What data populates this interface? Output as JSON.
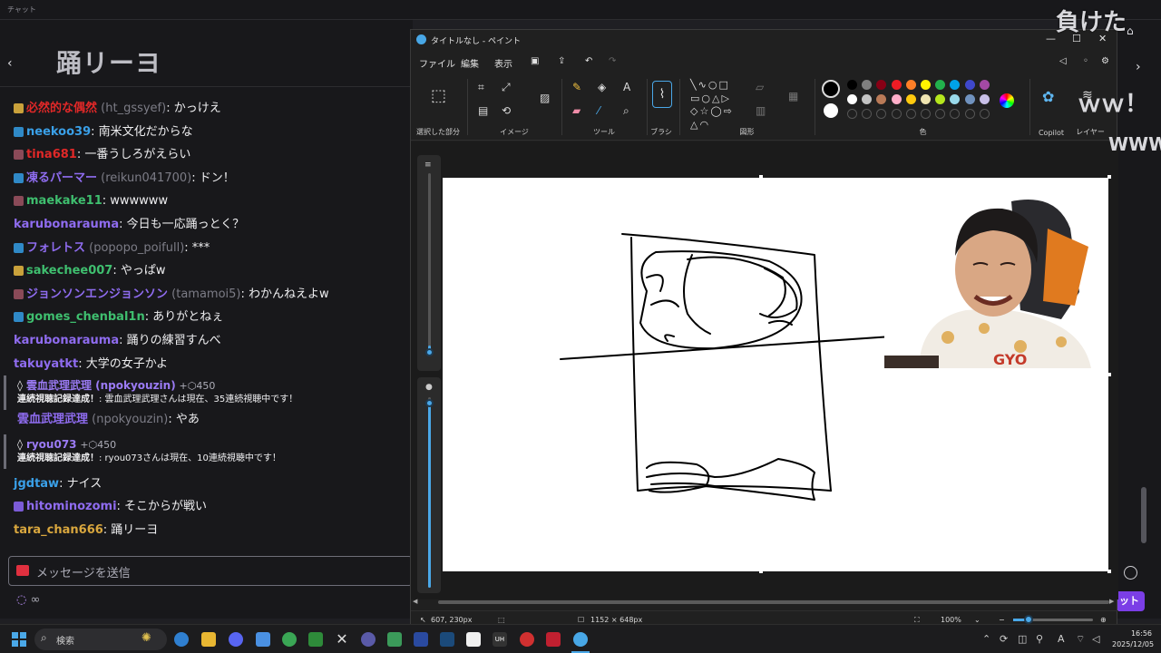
{
  "top_strip": {
    "label": "チャット"
  },
  "overlay": {
    "makeru": "負けた",
    "ww1": "ｗｗ！",
    "ww2": "WWW"
  },
  "chat": {
    "header_title": "踊リーヨ",
    "messages": [
      {
        "user": "必然的な偶然",
        "sub": "(ht_gssyef)",
        "text": ": かっけえ",
        "color": "#e02828",
        "badge": "g"
      },
      {
        "user": "neekoo39",
        "sub": "",
        "text": ": 南米文化だからな",
        "color": "#3aa0e8",
        "badge": "b"
      },
      {
        "user": "tina681",
        "sub": "",
        "text": ": 一番うしろがえらい",
        "color": "#e02828",
        "badge": "r"
      },
      {
        "user": "凍るパーマー",
        "sub": "(reikun041700)",
        "text": ": ドン！",
        "color": "#8f6cf0",
        "badge": "b"
      },
      {
        "user": "maekake11",
        "sub": "",
        "text": ": wwwwww",
        "color": "#3fbf6f",
        "badge": "r"
      },
      {
        "user": "karubonarauma",
        "sub": "",
        "text": ": 今日も一応踊っとく？",
        "color": "#8f6cf0",
        "badge": ""
      },
      {
        "user": "フォレトス",
        "sub": "(popopo_poifull)",
        "text": ": ***",
        "color": "#8f6cf0",
        "badge": "b"
      },
      {
        "user": "sakechee007",
        "sub": "",
        "text": ": やっぱw",
        "color": "#3fbf6f",
        "badge": "g"
      },
      {
        "user": "ジョンソンエンジョンソン",
        "sub": "(tamamoi5)",
        "text": ": わかんねえよw",
        "color": "#8f6cf0",
        "badge": "r"
      },
      {
        "user": "gomes_chenbal1n",
        "sub": "",
        "text": ": ありがとねぇ",
        "color": "#3fbf6f",
        "badge": "b"
      },
      {
        "user": "karubonarauma",
        "sub": "",
        "text": ": 踊りの練習すんべ",
        "color": "#8f6cf0",
        "badge": ""
      },
      {
        "user": "takuyatkt",
        "sub": "",
        "text": ": 大学の女子かよ",
        "color": "#8f6cf0",
        "badge": ""
      }
    ],
    "notice1": {
      "user": "雲血武理武理 (npokyouzin)",
      "points": "+⬡450",
      "label": "連続視聴記録達成！",
      "text": ": 雲血武理武理さんは現在、35連続視聴中です！"
    },
    "after_notice1": {
      "user": "雲血武理武理",
      "sub": "(npokyouzin)",
      "text": ": やあ",
      "color": "#8f6cf0"
    },
    "notice2": {
      "user": "ryou073",
      "points": "+⬡450",
      "label": "連続視聴記録達成！",
      "text": ": ryou073さんは現在、10連続視聴中です！"
    },
    "tail": [
      {
        "user": "jgdtaw",
        "sub": "",
        "text": ": ナイス",
        "color": "#3aa0e8",
        "badge": ""
      },
      {
        "user": "hitominozomi",
        "sub": "",
        "text": ": そこからが戦い",
        "color": "#8f6cf0",
        "badge": "p"
      },
      {
        "user": "tara_chan666",
        "sub": "",
        "text": ": 踊リーヨ",
        "color": "#d9a73e",
        "badge": ""
      }
    ],
    "input_placeholder": "メッセージを送信",
    "infinite": "∞",
    "send_button": "ット"
  },
  "paint": {
    "title": "タイトルなし - ペイント",
    "menu": [
      "ファイル",
      "編集",
      "表示"
    ],
    "groups": {
      "select": "選択した部分",
      "image": "イメージ",
      "tools": "ツール",
      "brush": "ブラシ",
      "shapes": "図形",
      "colors": "色",
      "copilot": "Copilot",
      "layers": "レイヤー"
    },
    "status": {
      "cursor": "607, 230px",
      "size": "1152 × 648px",
      "zoom": "100%"
    },
    "palette_row1": [
      "#000000",
      "#7f7f7f",
      "#880015",
      "#ed1c24",
      "#ff7f27",
      "#fff200",
      "#22b14c",
      "#00a2e8",
      "#3f48cc",
      "#a349a4"
    ],
    "palette_row2": [
      "#ffffff",
      "#c3c3c3",
      "#b97a57",
      "#ffaec9",
      "#ffc90e",
      "#efe4b0",
      "#b5e61d",
      "#99d9ea",
      "#7092be",
      "#c8bfe7"
    ]
  },
  "taskbar": {
    "search": "検索",
    "time": "16:56",
    "date": "2025/12/05"
  }
}
